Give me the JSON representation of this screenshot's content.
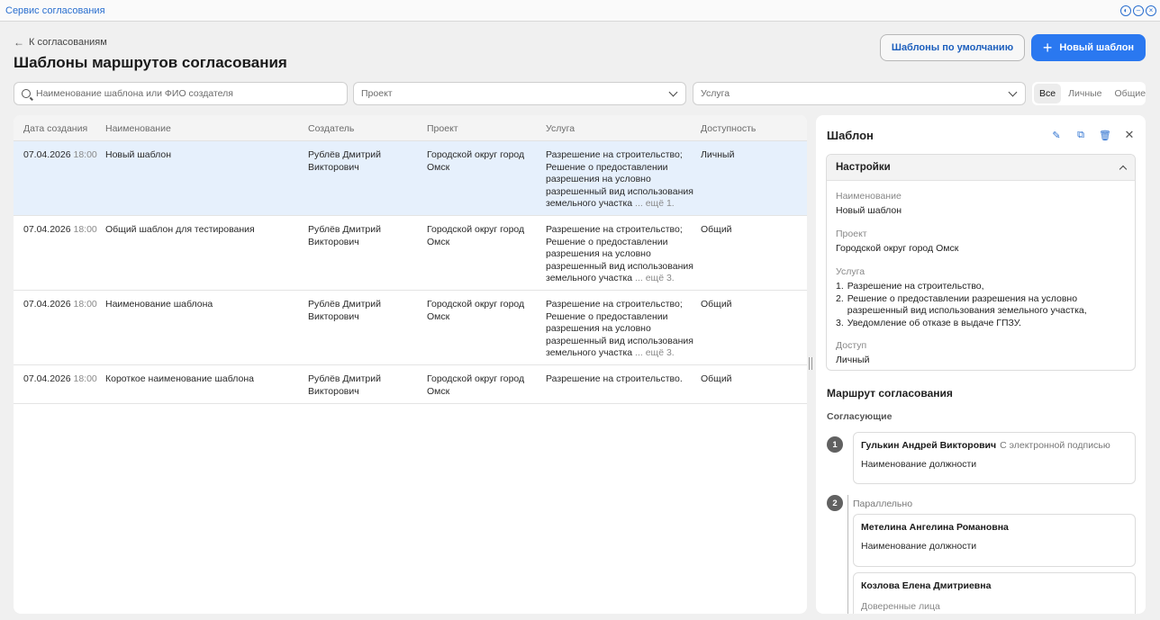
{
  "window": {
    "title": "Сервис согласования",
    "controls": [
      "theme-icon",
      "minimize-icon",
      "close-icon"
    ]
  },
  "header": {
    "back_label": "К согласованиям",
    "title": "Шаблоны маршрутов согласования",
    "defaults_button": "Шаблоны по умолчанию",
    "new_button": "Новый шаблон"
  },
  "filters": {
    "search_placeholder": "Наименование шаблона или ФИО создателя",
    "project_placeholder": "Проект",
    "service_placeholder": "Услуга",
    "segments": [
      "Все",
      "Личные",
      "Общие"
    ],
    "active_segment": "Все"
  },
  "table": {
    "columns": [
      "Дата создания",
      "Наименование",
      "Создатель",
      "Проект",
      "Услуга",
      "Доступность"
    ],
    "rows": [
      {
        "date": "07.04.2026",
        "time": "18:00",
        "name": "Новый шаблон",
        "creator": "Рублёв Дмитрий Викторович",
        "project": "Городской округ город Омск",
        "service": "Разрешение на строительство; Решение о предоставлении разрешения на условно разрешенный вид использования земельного участка",
        "service_more": "... ещё 1.",
        "access": "Личный",
        "selected": true
      },
      {
        "date": "07.04.2026",
        "time": "18:00",
        "name": "Общий шаблон для тестирования",
        "creator": "Рублёв Дмитрий Викторович",
        "project": "Городской округ город Омск",
        "service": "Разрешение на строительство; Решение о предоставлении разрешения на условно разрешенный вид использования земельного участка",
        "service_more": "... ещё 3.",
        "access": "Общий",
        "selected": false
      },
      {
        "date": "07.04.2026",
        "time": "18:00",
        "name": "Наименование шаблона",
        "creator": "Рублёв Дмитрий Викторович",
        "project": "Городской округ город Омск",
        "service": "Разрешение на строительство; Решение о предоставлении разрешения на условно разрешенный вид использования земельного участка",
        "service_more": "... ещё 3.",
        "access": "Общий",
        "selected": false
      },
      {
        "date": "07.04.2026",
        "time": "18:00",
        "name": "Короткое наименование шаблона",
        "creator": "Рублёв Дмитрий Викторович",
        "project": "Городской округ город Омск",
        "service": "Разрешение на строительство.",
        "service_more": "",
        "access": "Общий",
        "selected": false
      }
    ]
  },
  "detail": {
    "title": "Шаблон",
    "actions": [
      "edit-icon",
      "copy-icon",
      "delete-icon",
      "close-icon"
    ],
    "settings": {
      "title": "Настройки",
      "name_label": "Наименование",
      "name_value": "Новый шаблон",
      "project_label": "Проект",
      "project_value": "Городской округ город Омск",
      "service_label": "Услуга",
      "services": [
        "Разрешение на строительство,",
        "Решение о предоставлении разрешения на условно разрешенный вид использования земельного участка,",
        "Уведомление об отказе в выдаче ГПЗУ."
      ],
      "access_label": "Доступ",
      "access_value": "Личный"
    },
    "route": {
      "title": "Маршрут согласования",
      "approvers_label": "Согласующие",
      "step1": {
        "number": "1",
        "name": "Гулькин Андрей Викторович",
        "note": "С электронной подписью",
        "position": "Наименование должности"
      },
      "step2": {
        "number": "2",
        "mode": "Параллельно",
        "persons": [
          {
            "name": "Метелина Ангелина Романовна",
            "position": "Наименование должности"
          },
          {
            "name": "Козлова Елена Дмитриевна",
            "trusted_label": "Доверенные лица"
          }
        ]
      }
    }
  }
}
